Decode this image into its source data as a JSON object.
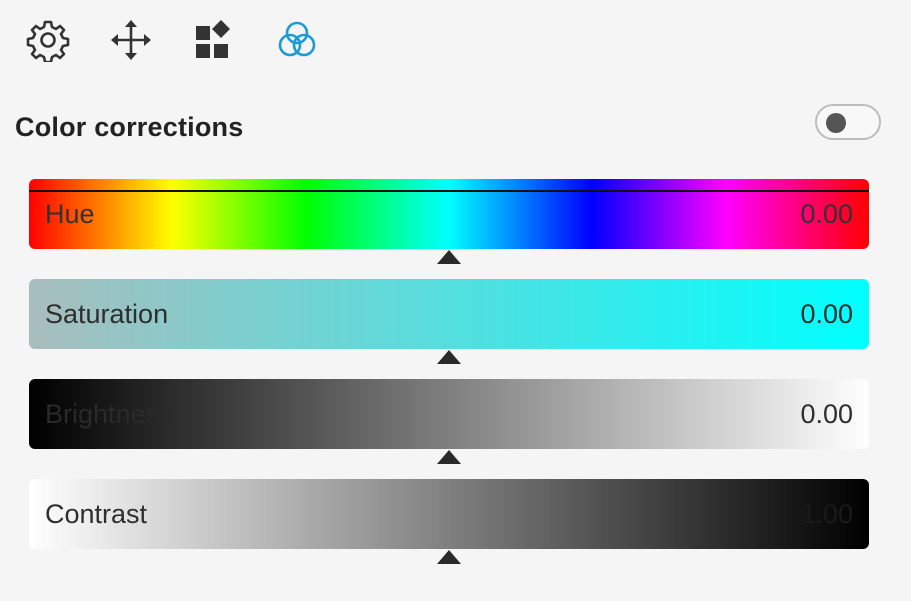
{
  "toolbar": {
    "items": [
      {
        "icon": "gear-icon",
        "active": false
      },
      {
        "icon": "move-arrows-icon",
        "active": false
      },
      {
        "icon": "widgets-icon",
        "active": false
      },
      {
        "icon": "color-circles-icon",
        "active": true
      }
    ],
    "icon_color": "#333333",
    "active_color": "#1a9bd8"
  },
  "section": {
    "title": "Color corrections",
    "toggle_on": false
  },
  "sliders": {
    "hue": {
      "label": "Hue",
      "value": "0.00"
    },
    "saturation": {
      "label": "Saturation",
      "value": "0.00"
    },
    "brightness": {
      "label": "Brightness",
      "value": "0.00"
    },
    "contrast": {
      "label": "Contrast",
      "value": "1.00"
    }
  }
}
